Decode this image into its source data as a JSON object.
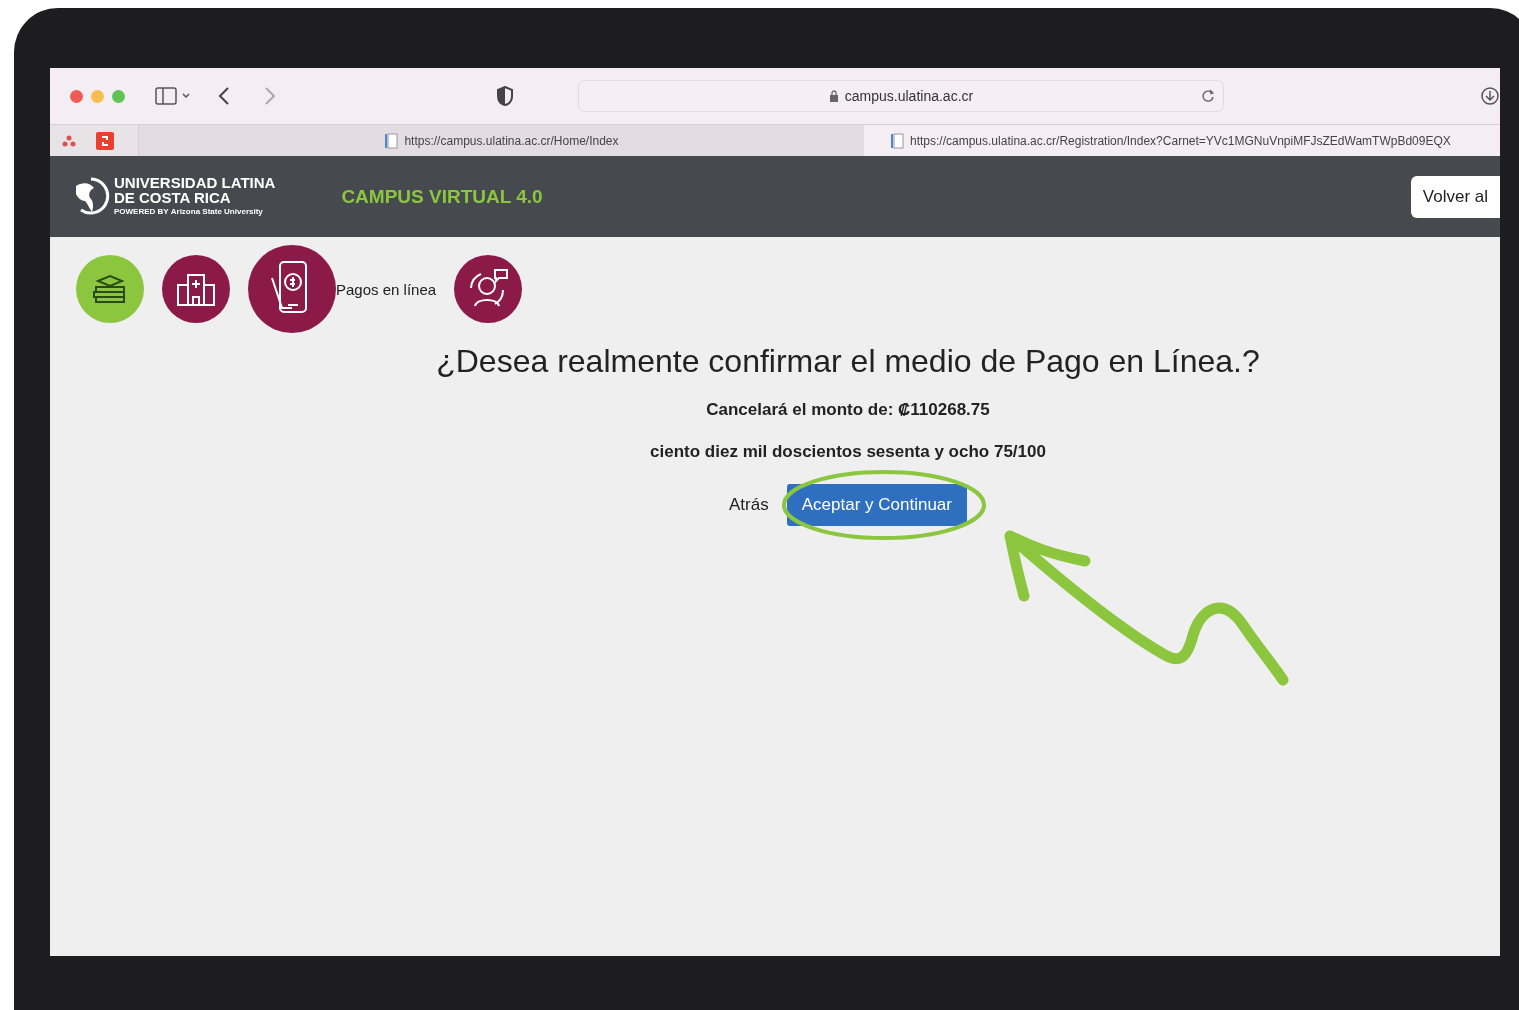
{
  "browser": {
    "address": "campus.ulatina.ac.cr",
    "tabs": [
      {
        "url": "https://campus.ulatina.ac.cr/Home/Index",
        "selected": false
      },
      {
        "url": "https://campus.ulatina.ac.cr/Registration/Index?Carnet=YVc1MGNuVnpiMFJsZEdWamTWpBd09EQX",
        "selected": true
      }
    ]
  },
  "header": {
    "logo_lines": [
      "UNIVERSIDAD LATINA",
      "DE COSTA RICA",
      "POWERED BY **Arizona State University**"
    ],
    "title": "CAMPUS VIRTUAL 4.0",
    "button": "Volver al"
  },
  "nav": [
    {
      "kind": "books",
      "color": "#8cc63f",
      "selected": false
    },
    {
      "kind": "clinic",
      "color": "#8b1a48",
      "selected": false
    },
    {
      "kind": "payment",
      "color": "#8b1a48",
      "selected": true,
      "label": "Pagos en línea"
    },
    {
      "kind": "support",
      "color": "#8b1a48",
      "selected": false
    }
  ],
  "dialog": {
    "title": "¿Desea realmente confirmar el medio de Pago en Línea.?",
    "amount": "Cancelará el monto de: ₡110268.75",
    "amount_words": "ciento diez mil doscientos sesenta y ocho 75/100",
    "back": "Atrás",
    "confirm": "Aceptar y Continuar"
  },
  "annotation": {
    "highlight_confirm": true,
    "arrow": true
  }
}
